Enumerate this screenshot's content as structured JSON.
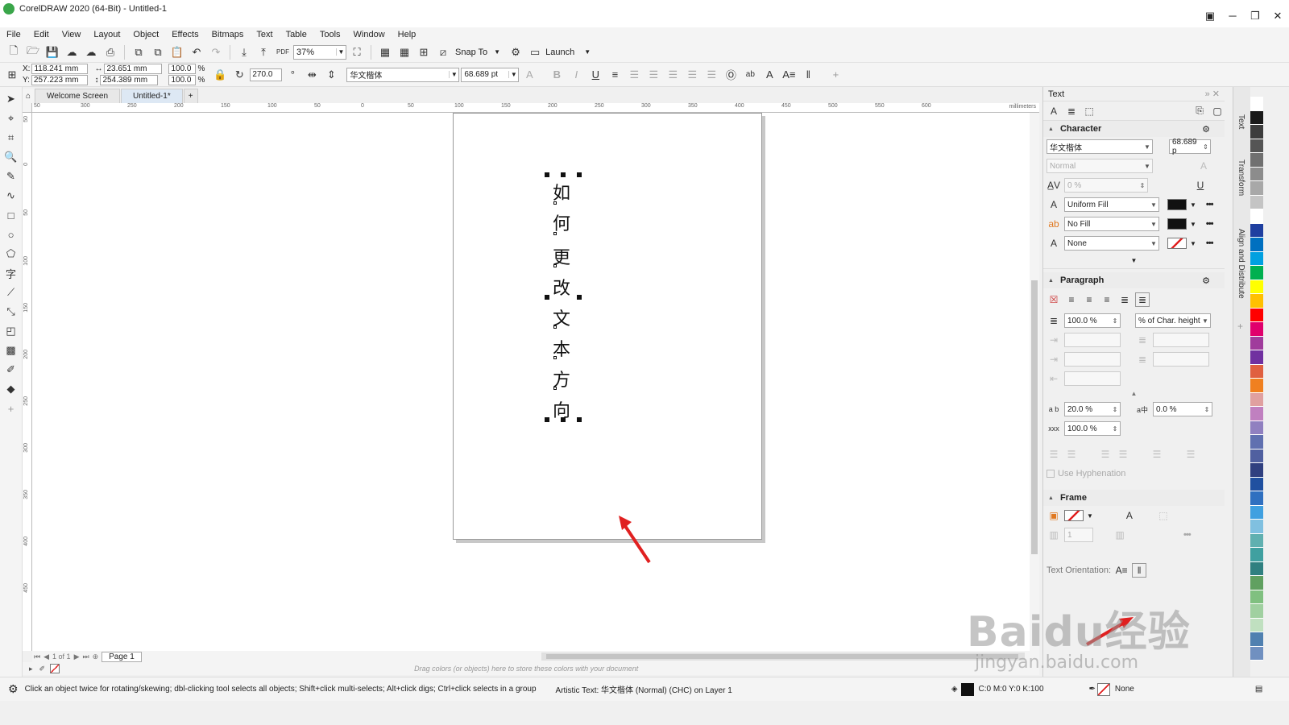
{
  "window": {
    "title": "CorelDRAW 2020 (64-Bit) - Untitled-1"
  },
  "menu": [
    "File",
    "Edit",
    "View",
    "Layout",
    "Object",
    "Effects",
    "Bitmaps",
    "Text",
    "Table",
    "Tools",
    "Window",
    "Help"
  ],
  "toolbar": {
    "zoom": "37%",
    "snap_to": "Snap To",
    "launch": "Launch"
  },
  "props": {
    "x_label": "X:",
    "x": "118.241 mm",
    "y_label": "Y:",
    "y": "257.223 mm",
    "w": "23.651 mm",
    "h": "254.389 mm",
    "sx": "100.0",
    "sy": "100.0",
    "pct": "%",
    "rotation": "270.0",
    "font": "华文楷体",
    "font_size": "68.689 pt"
  },
  "tabs": {
    "welcome": "Welcome Screen",
    "doc": "Untitled-1*"
  },
  "ruler": {
    "unit": "millimeters",
    "h_ticks": [
      "50",
      "300",
      "250",
      "200",
      "150",
      "100",
      "50",
      "0",
      "50",
      "100",
      "150",
      "200",
      "250",
      "300",
      "350",
      "400",
      "450",
      "500",
      "550",
      "600"
    ],
    "v_ticks": [
      "50",
      "0",
      "50",
      "100",
      "150",
      "200",
      "250",
      "300",
      "350",
      "400",
      "450"
    ]
  },
  "canvas_text": [
    "如",
    "何",
    "更",
    "改",
    "文",
    "本",
    "方",
    "向"
  ],
  "pagebar": {
    "of": "1 of 1",
    "page": "Page 1"
  },
  "colorwell_hint": "Drag colors (or objects) here to store these colors with your document",
  "status": {
    "hint": "Click an object twice for rotating/skewing; dbl-clicking tool selects all objects; Shift+click multi-selects; Alt+click digs; Ctrl+click selects in a group",
    "object": "Artistic Text: 华文楷体 (Normal) (CHC) on Layer 1",
    "fill": "C:0 M:0 Y:0 K:100",
    "outline": "None"
  },
  "docker": {
    "title": "Text",
    "character": "Character",
    "font": "华文楷体",
    "size": "68.689 p",
    "style": "Normal",
    "kerning": "0 %",
    "fill1": "Uniform Fill",
    "fill2": "No Fill",
    "fill3": "None",
    "paragraph": "Paragraph",
    "line_spacing": "100.0 %",
    "spacing_unit": "% of Char. height",
    "char_spacing": "20.0 %",
    "word_spacing": "0.0 %",
    "lang_spacing": "100.0 %",
    "hyphenation": "Use Hyphenation",
    "frame": "Frame",
    "columns": "1",
    "orientation": "Text Orientation:"
  },
  "side_tabs": [
    "Text",
    "Transform",
    "Align and Distribute"
  ],
  "watermark": {
    "brand": "Baidu经验",
    "url": "jingyan.baidu.com"
  },
  "colors": {
    "accent": "#3aa64a",
    "arrow": "#e02020"
  }
}
